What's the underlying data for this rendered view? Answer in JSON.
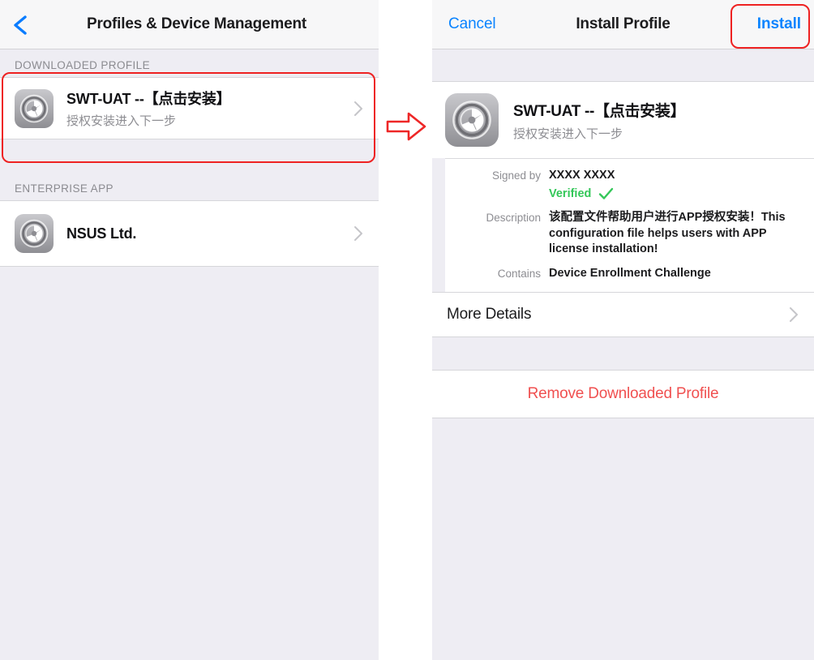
{
  "left_panel": {
    "navbar": {
      "back_icon": "chevron-left-icon",
      "title": "Profiles & Device Management"
    },
    "sections": [
      {
        "header": "DOWNLOADED PROFILE",
        "rows": [
          {
            "icon": "settings-gear-icon",
            "title": "SWT-UAT --【点击安装】",
            "subtitle": "授权安装进入下一步",
            "accessory": "chevron-right-icon"
          }
        ]
      },
      {
        "header": "ENTERPRISE APP",
        "rows": [
          {
            "icon": "settings-gear-icon",
            "title": "NSUS Ltd.",
            "subtitle": "",
            "accessory": "chevron-right-icon"
          }
        ]
      }
    ]
  },
  "flow": {
    "arrow_icon": "arrow-right-icon"
  },
  "right_panel": {
    "navbar": {
      "cancel_label": "Cancel",
      "title": "Install Profile",
      "install_label": "Install"
    },
    "profile": {
      "icon": "settings-gear-icon",
      "name": "SWT-UAT --【点击安装】",
      "description": "授权安装进入下一步"
    },
    "details": [
      {
        "label": "Signed by",
        "value": "XXXX XXXX",
        "status": "Verified",
        "status_icon": "checkmark-icon"
      },
      {
        "label": "Description",
        "value": "该配置文件帮助用户进行APP授权安装！This configuration file helps users with APP license installation!"
      },
      {
        "label": "Contains",
        "value": "Device Enrollment Challenge"
      }
    ],
    "more_details": {
      "label": "More Details",
      "accessory": "chevron-right-icon"
    },
    "remove": {
      "label": "Remove Downloaded Profile"
    }
  },
  "colors": {
    "accent_blue": "#0a84ff",
    "annotation_red": "#ee2222",
    "destructive_red": "#f05050",
    "verified_green": "#34c759",
    "panel_gray": "#eeedf3"
  }
}
